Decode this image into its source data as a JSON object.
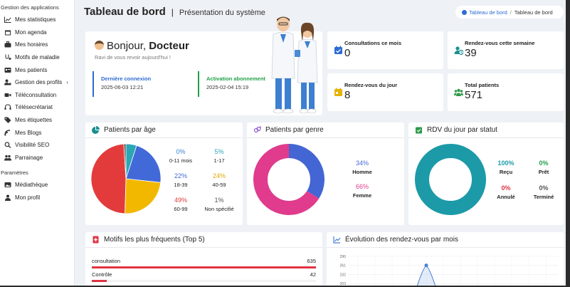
{
  "sidebar": {
    "section_apps": "Gestion des applications",
    "items": [
      {
        "label": "Mes statistiques",
        "icon": "chart-line-icon"
      },
      {
        "label": "Mon agenda",
        "icon": "calendar-icon"
      },
      {
        "label": "Mes horaires",
        "icon": "briefcase-icon"
      },
      {
        "label": "Motifs de maladie",
        "icon": "stethoscope-icon"
      },
      {
        "label": "Mes patients",
        "icon": "id-card-icon"
      },
      {
        "label": "Gestion des profils",
        "icon": "user-cog-icon",
        "has_submenu": true
      },
      {
        "label": "Téléconsultation",
        "icon": "video-icon"
      },
      {
        "label": "Télésecrétariat",
        "icon": "headset-icon"
      },
      {
        "label": "Mes étiquettes",
        "icon": "tag-icon"
      },
      {
        "label": "Mes Blogs",
        "icon": "blog-icon"
      },
      {
        "label": "Visibilité SEO",
        "icon": "search-icon"
      },
      {
        "label": "Parrainage",
        "icon": "users-icon"
      }
    ],
    "section_params": "Paramètres",
    "params_items": [
      {
        "label": "Médiathèque",
        "icon": "photo-icon"
      },
      {
        "label": "Mon profil",
        "icon": "user-icon"
      }
    ],
    "submenu_chevron": "‹"
  },
  "header": {
    "title": "Tableau de bord",
    "separator": "|",
    "subtitle": "Présentation du système",
    "breadcrumb": {
      "link": "Tableau de bord",
      "sep": "/",
      "current": "Tableau de bord"
    }
  },
  "welcome": {
    "greeting": "Bonjour,",
    "name": "Docteur",
    "subtitle": "Ravi de vous revoir aujourd'hui !",
    "last_login_label": "Dernière connexion",
    "last_login_value": "2025-06-03 12:21",
    "subscription_label": "Activation abonnement",
    "subscription_value": "2025-02-04 15:19"
  },
  "stats": [
    {
      "label": "Consultations ce mois",
      "value": "0",
      "color": "#2d6bd4"
    },
    {
      "label": "Rendez-vous cette semaine",
      "value": "39",
      "color": "#1c8f8f"
    },
    {
      "label": "Rendez-vous du jour",
      "value": "8",
      "color": "#e8b100"
    },
    {
      "label": "Total patients",
      "value": "571",
      "color": "#2e9a4a"
    }
  ],
  "age_panel": {
    "title": "Patients par âge",
    "groups": [
      {
        "pct": "0%",
        "label": "0-11 mois",
        "color": "#3a82d0"
      },
      {
        "pct": "5%",
        "label": "1-17",
        "color": "#2aa6b5"
      },
      {
        "pct": "22%",
        "label": "18-39",
        "color": "#4169d8"
      },
      {
        "pct": "24%",
        "label": "40-59",
        "color": "#f2b800"
      },
      {
        "pct": "49%",
        "label": "60-99",
        "color": "#e33b3b"
      },
      {
        "pct": "1%",
        "label": "Non spécifié",
        "color": "#555555"
      }
    ]
  },
  "gender_panel": {
    "title": "Patients par genre",
    "groups": [
      {
        "pct": "34%",
        "label": "Homme",
        "color": "#4465d4"
      },
      {
        "pct": "66%",
        "label": "Femme",
        "color": "#e03b8c"
      }
    ]
  },
  "rdv_panel": {
    "title": "RDV du jour par statut",
    "groups": [
      {
        "pct": "100%",
        "label": "Reçu",
        "color": "#1c9aa8"
      },
      {
        "pct": "0%",
        "label": "Prêt",
        "color": "#22a04a"
      },
      {
        "pct": "0%",
        "label": "Annulé",
        "color": "#e03442"
      },
      {
        "pct": "0%",
        "label": "Terminé",
        "color": "#555555"
      }
    ]
  },
  "motifs_panel": {
    "title": "Motifs les plus fréquents (Top 5)",
    "rows": [
      {
        "label": "consultation",
        "count": "635",
        "share": 1.0
      },
      {
        "label": "Contrôle",
        "count": "42",
        "share": 0.066
      }
    ]
  },
  "evolution_panel": {
    "title": "Évolution des rendez-vous par mois"
  },
  "chart_data": {
    "type": "line",
    "title": "Évolution des rendez-vous par mois",
    "y_ticks": [
      290,
      261,
      232,
      203
    ],
    "ylim": [
      203,
      290
    ],
    "peak_value": 261,
    "color": "#4a7fd4"
  }
}
